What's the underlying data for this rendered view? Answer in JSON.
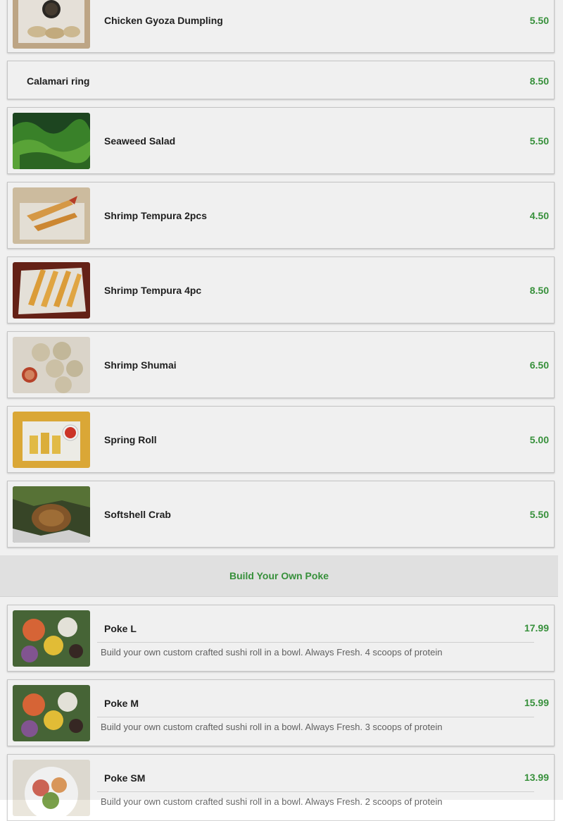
{
  "items": [
    {
      "name": "Chicken Gyoza Dumpling",
      "price": "5.50",
      "image": "gyoza-box-photo"
    },
    {
      "name": "Calamari ring",
      "price": "8.50"
    },
    {
      "name": "Seaweed Salad",
      "price": "5.50",
      "image": "seaweed-salad-photo"
    },
    {
      "name": "Shrimp Tempura 2pcs",
      "price": "4.50",
      "image": "shrimp-tempura-2pcs-photo"
    },
    {
      "name": "Shrimp Tempura 4pc",
      "price": "8.50",
      "image": "shrimp-tempura-4pc-photo"
    },
    {
      "name": "Shrimp Shumai",
      "price": "6.50",
      "image": "shrimp-shumai-photo"
    },
    {
      "name": "Spring Roll",
      "price": "5.00",
      "image": "spring-roll-photo"
    },
    {
      "name": "Softshell Crab",
      "price": "5.50",
      "image": "softshell-crab-photo"
    }
  ],
  "section": {
    "title": "Build Your Own Poke"
  },
  "poke": [
    {
      "name": "Poke L",
      "price": "17.99",
      "description": "Build your own custom crafted sushi roll in a bowl. Always Fresh. 4 scoops of protein",
      "image": "poke-bowl-photo"
    },
    {
      "name": "Poke M",
      "price": "15.99",
      "description": "Build your own custom crafted sushi roll in a bowl. Always Fresh. 3 scoops of protein",
      "image": "poke-bowl-photo"
    },
    {
      "name": "Poke SM",
      "price": "13.99",
      "description": "Build your own custom crafted sushi roll in a bowl. Always Fresh. 2 scoops of protein",
      "image": "poke-bowl-photo"
    }
  ],
  "colors": {
    "price": "#3b9a3f",
    "section_bg": "#eeeeee",
    "card_border": "#d2d2d2"
  }
}
